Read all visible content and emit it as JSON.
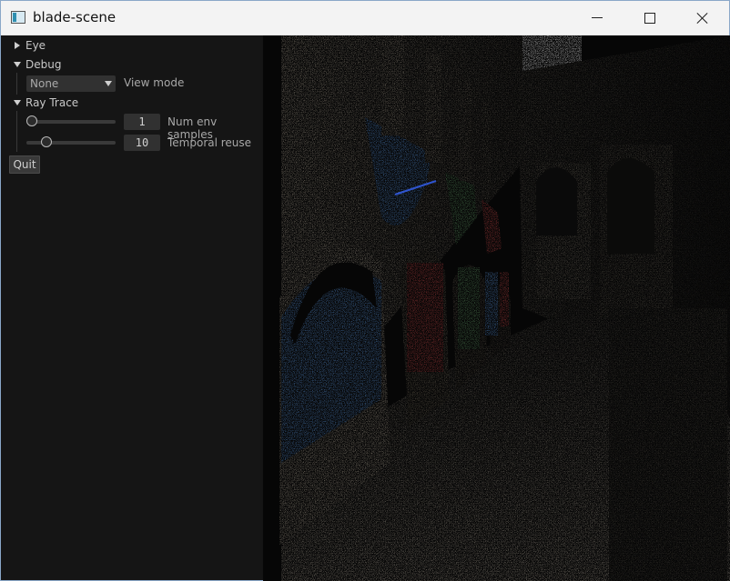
{
  "window": {
    "title": "blade-scene"
  },
  "panel": {
    "eye_label": "Eye",
    "debug_label": "Debug",
    "view_mode_value": "None",
    "view_mode_label": "View mode",
    "ray_trace_label": "Ray Trace",
    "num_env_samples_value": "1",
    "num_env_samples_label": "Num env samples",
    "temporal_reuse_value": "10",
    "temporal_reuse_label": "Temporal reuse",
    "quit_label": "Quit"
  },
  "colors": {
    "panel_bg": "#151515",
    "viewport_bg": "#080808",
    "stone": "#7c7468",
    "cloth_blue": "#4a7ab5",
    "cloth_red": "#a33a3a",
    "cloth_green": "#4f7b52"
  }
}
